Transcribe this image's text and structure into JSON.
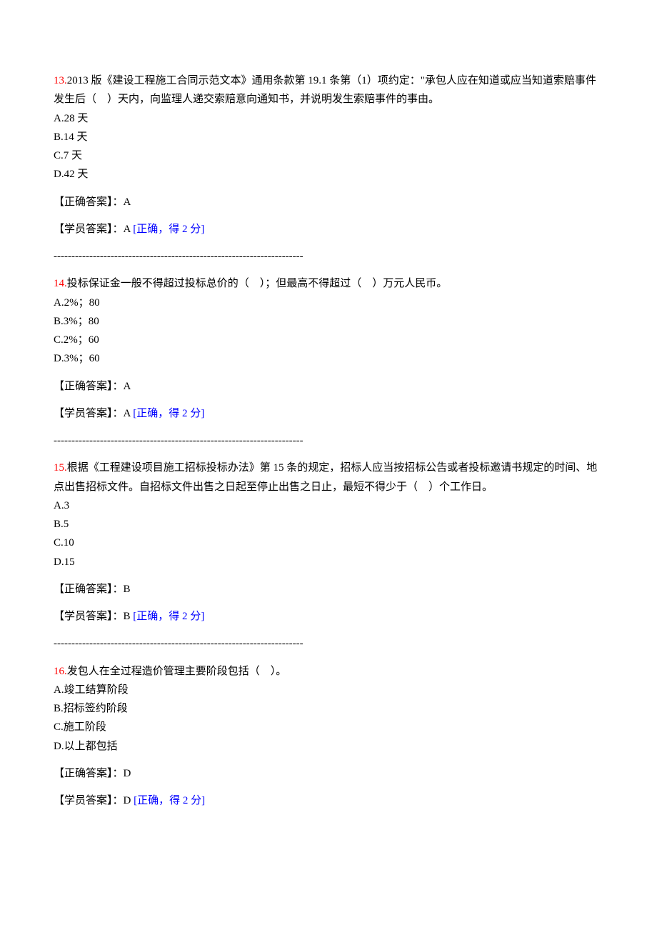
{
  "separator": "----------------------------------------------------------------------",
  "labels": {
    "correct_prefix": "【正确答案】：",
    "student_prefix": "【学员答案】："
  },
  "questions": [
    {
      "num": "13.",
      "text": "2013 版《建设工程施工合同示范文本》通用条款第 19.1 条第（1）项约定：\"承包人应在知道或应当知道索赔事件发生后（　）天内，向监理人递交索赔意向通知书，并说明发生索赔事件的事由。",
      "options": [
        "A.28 天",
        "B.14 天",
        "C.7 天",
        "D.42 天"
      ],
      "correct": "A",
      "student": "A",
      "result": "[正确，得 2 分]"
    },
    {
      "num": "14.",
      "text": "投标保证金一般不得超过投标总价的（　）；但最高不得超过（　）万元人民币。",
      "options": [
        "A.2%；80",
        "B.3%；80",
        "C.2%；60",
        "D.3%；60"
      ],
      "correct": "A",
      "student": "A",
      "result": "[正确，得 2 分]"
    },
    {
      "num": "15.",
      "text": "根据《工程建设项目施工招标投标办法》第 15 条的规定，招标人应当按招标公告或者投标邀请书规定的时间、地点出售招标文件。自招标文件出售之日起至停止出售之日止，最短不得少于（　）个工作日。",
      "options": [
        "A.3",
        "B.5",
        "C.10",
        "D.15"
      ],
      "correct": "B",
      "student": "B",
      "result": "[正确，得 2 分]"
    },
    {
      "num": "16.",
      "text": "发包人在全过程造价管理主要阶段包括（　）。",
      "options": [
        "A.竣工结算阶段",
        "B.招标签约阶段",
        "C.施工阶段",
        "D.以上都包括"
      ],
      "correct": "D",
      "student": "D",
      "result": "[正确，得 2 分]"
    }
  ]
}
